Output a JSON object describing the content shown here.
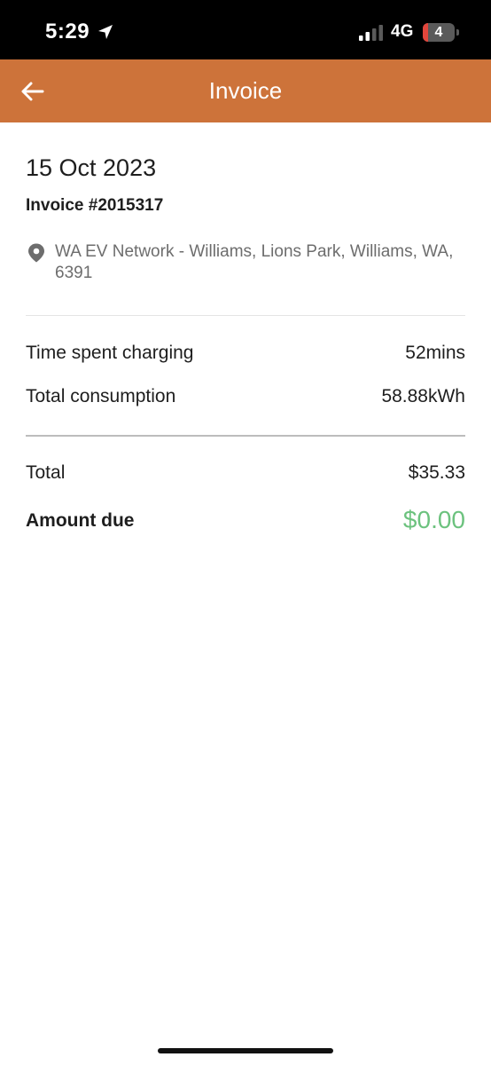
{
  "status_bar": {
    "time": "5:29",
    "network": "4G",
    "battery_level": "4",
    "location_icon": "location-arrow-icon",
    "signal_icon": "cellular-signal-icon"
  },
  "header": {
    "title": "Invoice",
    "back_icon": "back-arrow-icon",
    "background_color": "#cd733a"
  },
  "invoice": {
    "date": "15 Oct 2023",
    "number": "Invoice #2015317",
    "location_icon": "map-pin-icon",
    "address": "WA EV Network - Williams, Lions Park, Williams, WA, 6391"
  },
  "charging": {
    "time_label": "Time spent charging",
    "time_value": "52mins",
    "consumption_label": "Total consumption",
    "consumption_value": "58.88kWh"
  },
  "totals": {
    "total_label": "Total",
    "total_value": "$35.33",
    "amount_due_label": "Amount due",
    "amount_due_value": "$0.00",
    "amount_due_color": "#6cc27e"
  }
}
